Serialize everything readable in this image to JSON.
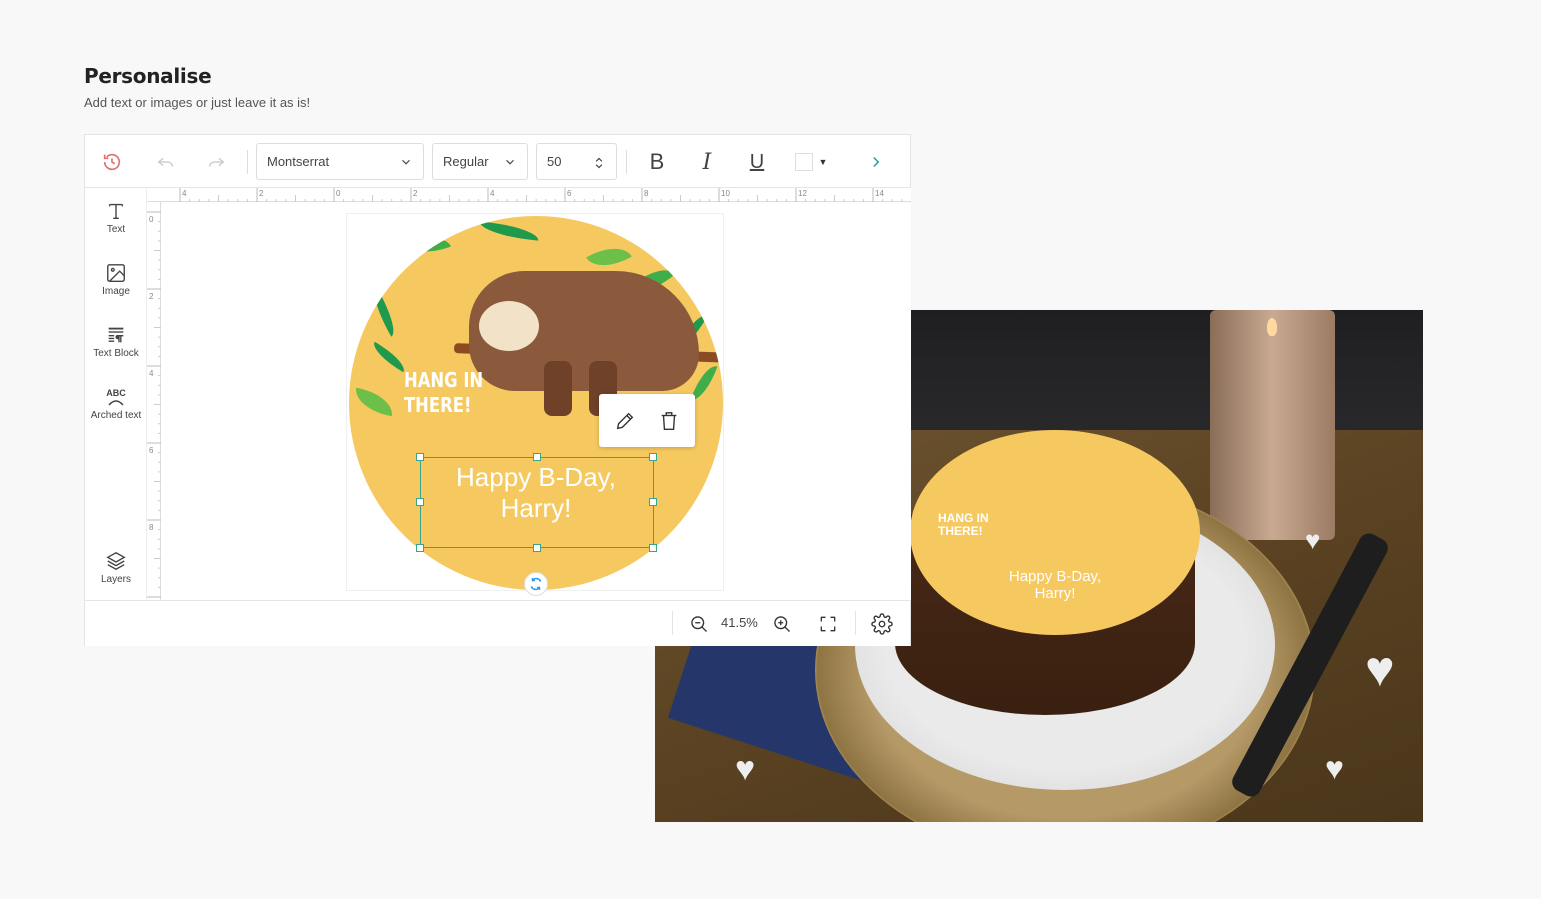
{
  "header": {
    "title": "Personalise",
    "subtitle": "Add text or images or just leave it as is!"
  },
  "toolbar": {
    "history_icon": "history-icon",
    "undo_icon": "undo-icon",
    "redo_icon": "redo-icon",
    "font_family": "Montserrat",
    "font_weight": "Regular",
    "font_size": "50",
    "bold_label": "B",
    "italic_label": "I",
    "underline_label": "U",
    "text_color": "#ffffff",
    "more_icon": "chevron-right-icon"
  },
  "sidebar": {
    "items": [
      {
        "label": "Text",
        "icon": "text-icon"
      },
      {
        "label": "Image",
        "icon": "image-icon"
      },
      {
        "label": "Text Block",
        "icon": "text-block-icon"
      },
      {
        "label": "Arched text",
        "icon": "arched-text-icon"
      },
      {
        "label": "Layers",
        "icon": "layers-icon"
      }
    ]
  },
  "rulers": {
    "horizontal_ticks": [
      "4",
      "2",
      "0",
      "2",
      "4",
      "6",
      "8",
      "10",
      "12",
      "14"
    ],
    "vertical_ticks": [
      "0",
      "2",
      "4",
      "6",
      "8"
    ]
  },
  "design": {
    "background_color": "#f6c860",
    "headline_line1": "HANG IN",
    "headline_line2": "THERE!",
    "text_line1": "Happy B-Day,",
    "text_line2": "Harry!"
  },
  "context_menu": {
    "edit_icon": "pencil-icon",
    "delete_icon": "trash-icon"
  },
  "bottom_bar": {
    "zoom_level": "41.5%",
    "zoom_out_icon": "zoom-out-icon",
    "zoom_in_icon": "zoom-in-icon",
    "fullscreen_icon": "fullscreen-icon",
    "settings_icon": "gear-icon"
  },
  "preview": {
    "cake_headline_line1": "HANG IN",
    "cake_headline_line2": "THERE!",
    "cake_text_line1": "Happy B-Day,",
    "cake_text_line2": "Harry!"
  },
  "colors": {
    "accent": "#3aa58a",
    "history": "#e07070",
    "chevron": "#2aa198",
    "rotate": "#2196f3"
  }
}
